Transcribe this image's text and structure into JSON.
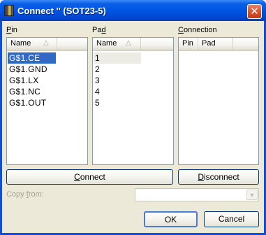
{
  "window": {
    "title": "Connect '' (SOT23-5)",
    "close_glyph": "✕"
  },
  "pin_panel": {
    "label_prefix": "",
    "label_ul": "P",
    "label_rest": "in",
    "column_header": "Name",
    "items": [
      "G$1.CE",
      "G$1.GND",
      "G$1.LX",
      "G$1.NC",
      "G$1.OUT"
    ],
    "selected_index": 0
  },
  "pad_panel": {
    "label_ul": "",
    "label_prefix": "Pa",
    "label_underlined": "d",
    "column_header": "Name",
    "items": [
      "1",
      "2",
      "3",
      "4",
      "5"
    ],
    "highlighted_index": 0
  },
  "connection_panel": {
    "label_ul": "C",
    "label_rest": "onnection",
    "columns": [
      "Pin",
      "Pad"
    ]
  },
  "buttons": {
    "connect_ul": "C",
    "connect_rest": "onnect",
    "disconnect_ul": "D",
    "disconnect_rest": "isconnect",
    "ok": "OK",
    "cancel": "Cancel"
  },
  "copy_from": {
    "label_prefix": "Copy ",
    "label_ul": "f",
    "label_rest": "rom:",
    "value": ""
  },
  "icons": {
    "sort": "sort-ascending-icon",
    "combo_arrow": "chevron-down-icon",
    "close": "close-icon"
  }
}
